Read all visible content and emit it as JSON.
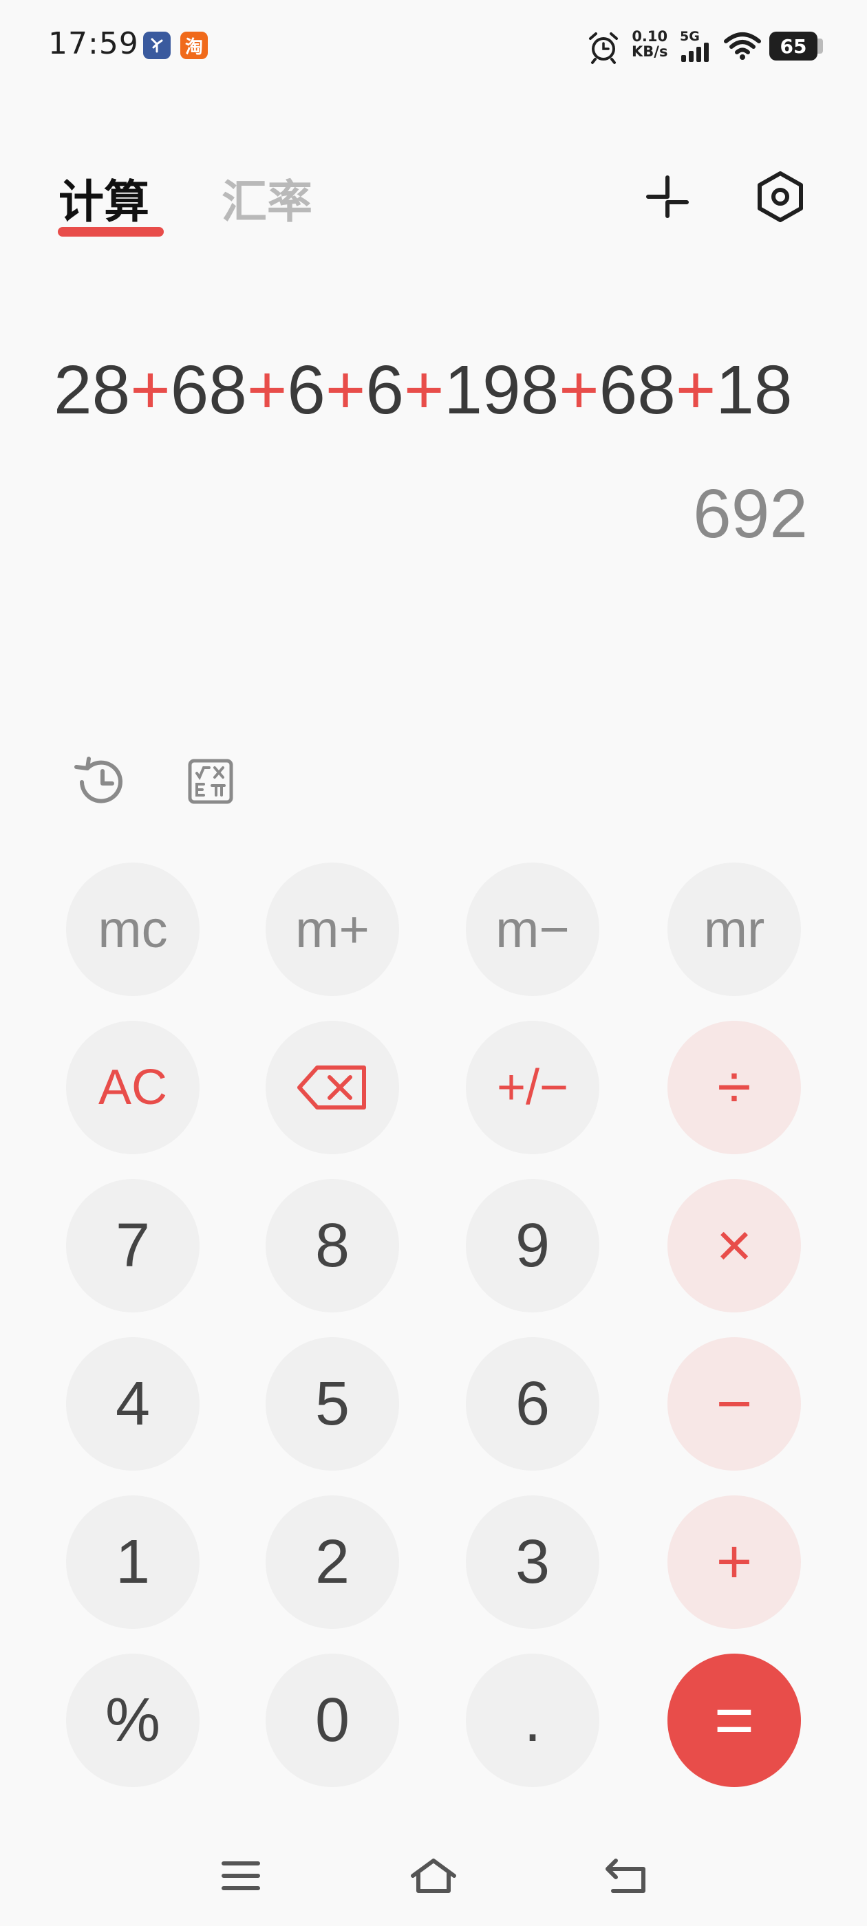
{
  "status_bar": {
    "time": "17:59",
    "app_icons": [
      "应",
      "淘"
    ],
    "net_speed_value": "0.10",
    "net_speed_unit": "KB/s",
    "network": "5G",
    "battery": "65"
  },
  "tabs": [
    {
      "label": "计算",
      "active": true
    },
    {
      "label": "汇率",
      "active": false
    }
  ],
  "toolbar_icons": [
    "minimize-icon",
    "settings-icon"
  ],
  "display": {
    "expression": [
      {
        "t": "28",
        "op": false
      },
      {
        "t": "+",
        "op": true
      },
      {
        "t": "68",
        "op": false
      },
      {
        "t": "+",
        "op": true
      },
      {
        "t": "6",
        "op": false
      },
      {
        "t": "+",
        "op": true
      },
      {
        "t": "6",
        "op": false
      },
      {
        "t": "+",
        "op": true
      },
      {
        "t": "198",
        "op": false
      },
      {
        "t": "+",
        "op": true
      },
      {
        "t": "68",
        "op": false
      },
      {
        "t": "+",
        "op": true
      },
      {
        "t": "18",
        "op": false
      }
    ],
    "result": "692"
  },
  "tools": [
    "history-icon",
    "scientific-icon"
  ],
  "keys": {
    "memory": [
      "mc",
      "m+",
      "m−",
      "mr"
    ],
    "ac": "AC",
    "sign": "+/−",
    "divide": "÷",
    "multiply": "×",
    "minus": "−",
    "plus": "+",
    "equals": "=",
    "percent": "%",
    "dot": ".",
    "digits": [
      "0",
      "1",
      "2",
      "3",
      "4",
      "5",
      "6",
      "7",
      "8",
      "9"
    ]
  },
  "colors": {
    "accent": "#e84d4a",
    "key_bg": "#f0f0f0",
    "op_key_bg": "#f7e7e6",
    "background": "#f9f9f9"
  }
}
